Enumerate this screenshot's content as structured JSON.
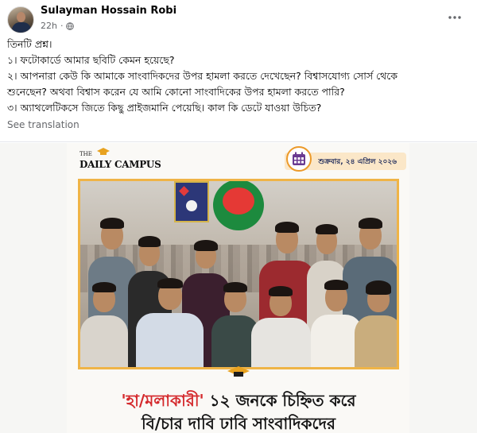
{
  "post": {
    "author": "Sulayman Hossain Robi",
    "time": "22h",
    "audience_icon": "globe-icon",
    "more_icon": "more-options-icon",
    "lines": [
      "তিনটি প্রশ্ন।",
      "১। ফটোকার্ডে আমার ছবিটি কেমন হয়েছে?",
      "২। আপনারা কেউ কি আমাকে সাংবাদিকদের উপর হামলা করতে দেখেছেন? বিশ্বাসযোগ্য সোর্স থেকে",
      "শুনেছেন? অথবা বিশ্বাস করেন যে আমি কোনো সাংবাদিকের উপর হামলা করতে পারি?",
      "৩। অ্যাথলেটিকসে জিতে কিছু প্রাইজমানি পেয়েছি। কাল কি ডেটে যাওয়া উচিত?"
    ],
    "see_translation": "See translation"
  },
  "photocard": {
    "logo_the": "THE",
    "logo_name": "DAILY CAMPUS",
    "date": "শুক্রবার, ২৪ এপ্রিল ২০২৬",
    "headline_red": "'হা/মলাকারী'",
    "headline_rest": " ১২ জনকে চিহ্নিত করে",
    "headline_line2": "বি/চার দাবি ঢাবি সাংবাদিকদের"
  },
  "colors": {
    "accent_orange": "#efb447",
    "headline_red": "#d4292c",
    "secondary_text": "#65676b"
  }
}
